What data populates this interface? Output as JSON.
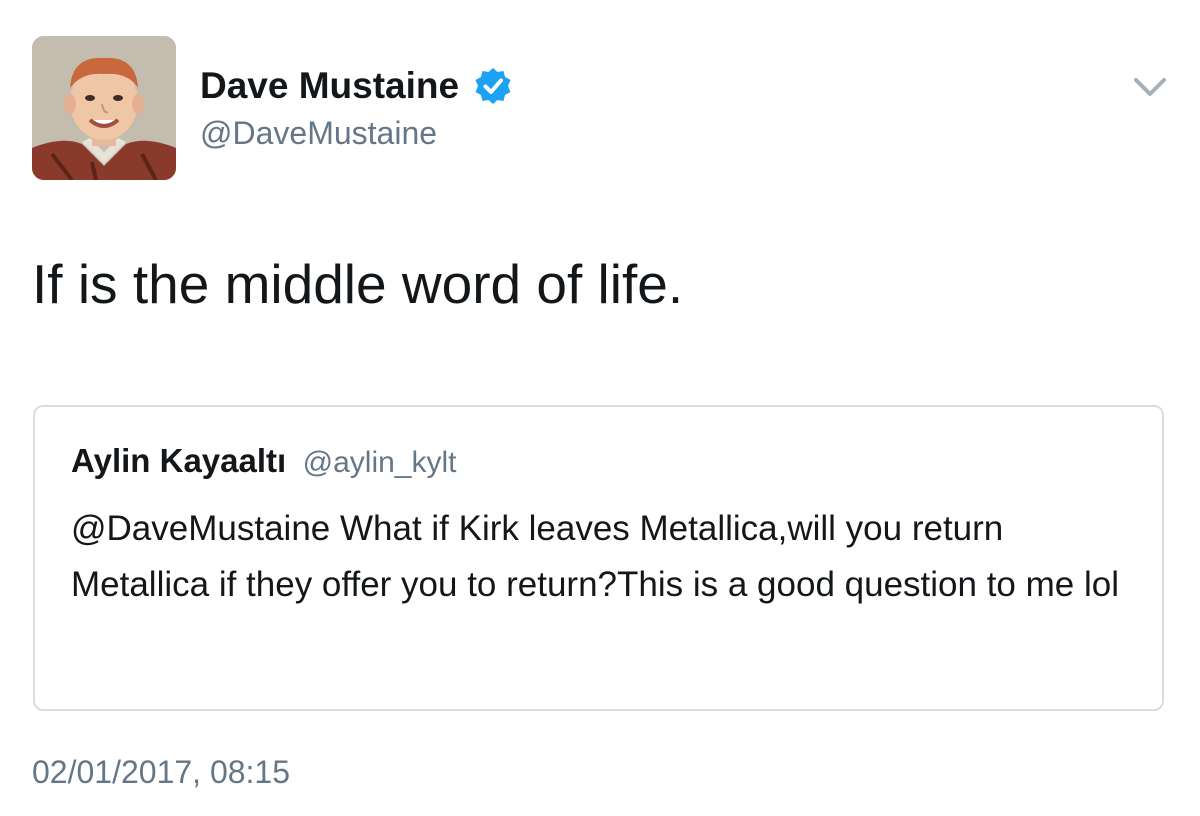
{
  "tweet": {
    "author": {
      "display_name": "Dave Mustaine",
      "handle": "@DaveMustaine",
      "verified": true,
      "avatar": "child-portrait-photo"
    },
    "text": "If is the middle word of life.",
    "quoted_tweet": {
      "display_name": "Aylin Kayaaltı",
      "handle": "@aylin_kylt",
      "text": "@DaveMustaine What if Kirk leaves Metallica,will you return Metallica if they offer you to return?This is a good question to me lol"
    },
    "timestamp": "02/01/2017, 08:15"
  },
  "icons": {
    "verified": "verified-badge-icon",
    "caret": "chevron-down-icon"
  },
  "colors": {
    "verified_blue": "#1da1f2",
    "secondary_text": "#657786",
    "primary_text": "#14171a",
    "border": "#d7dde1"
  }
}
